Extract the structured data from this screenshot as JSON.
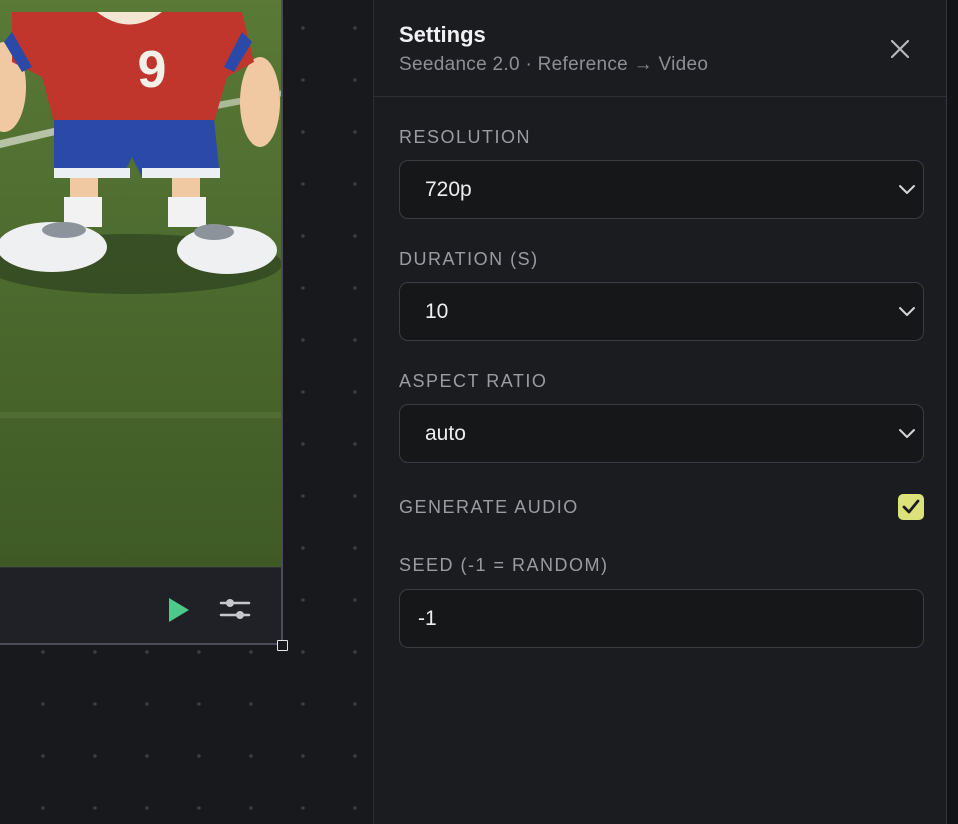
{
  "panel": {
    "title": "Settings",
    "subtitle": "Seedance 2.0 · Reference → Video"
  },
  "fields": {
    "resolution": {
      "label": "RESOLUTION",
      "value": "720p"
    },
    "duration": {
      "label": "DURATION (S)",
      "value": "10"
    },
    "aspect_ratio": {
      "label": "ASPECT RATIO",
      "value": "auto"
    },
    "generate_audio": {
      "label": "GENERATE AUDIO",
      "checked": true
    },
    "seed": {
      "label": "SEED (-1 = RANDOM)",
      "value": "-1"
    }
  },
  "preview": {
    "jersey_number": "9"
  },
  "colors": {
    "accent_check": "#dbe27a",
    "play_green": "#4fc98a",
    "jersey_red": "#c0362c",
    "shorts_blue": "#2a49a8",
    "grass": "#4c6a2e"
  },
  "icons": {
    "close": "close-icon",
    "chevron": "chevron-down-icon",
    "play": "play-icon",
    "tune": "sliders-icon",
    "check": "checkmark-icon"
  }
}
